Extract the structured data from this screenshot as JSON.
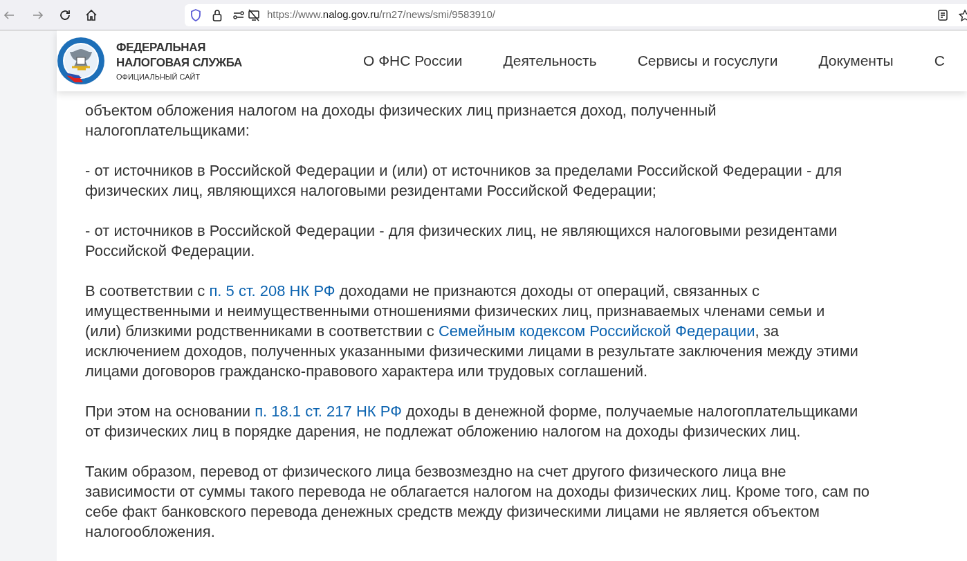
{
  "browser": {
    "url": {
      "prefix": "https://www.",
      "domain": "nalog.gov.ru",
      "path": "/rn27/news/smi/9583910/"
    }
  },
  "header": {
    "title_lines": [
      "ФЕДЕРАЛЬНАЯ",
      "НАЛОГОВАЯ СЛУЖБА"
    ],
    "subtitle": "ОФИЦИАЛЬНЫЙ САЙТ",
    "nav": [
      "О ФНС России",
      "Деятельность",
      "Сервисы и госуслуги",
      "Документы",
      "С"
    ]
  },
  "article": {
    "paragraphs": [
      [
        [
          {
            "text": "объектом обложения налогом на доходы физических лиц признается доход, полученный",
            "link": false
          }
        ],
        [
          {
            "text": "налогоплательщиками:",
            "link": false
          }
        ]
      ],
      [
        [
          {
            "text": "- от источников в Российской Федерации и (или) от источников за пределами Российской Федерации - для",
            "link": false
          }
        ],
        [
          {
            "text": "физических лиц, являющихся налоговыми резидентами Российской Федерации;",
            "link": false
          }
        ]
      ],
      [
        [
          {
            "text": "- от источников в Российской Федерации - для физических лиц, не являющихся налоговыми резидентами",
            "link": false
          }
        ],
        [
          {
            "text": "Российской Федерации.",
            "link": false
          }
        ]
      ],
      [
        [
          {
            "text": "В соответствии с ",
            "link": false
          },
          {
            "text": "п. 5 ст. 208 НК РФ",
            "link": true
          },
          {
            "text": " доходами не признаются доходы от операций, связанных с",
            "link": false
          }
        ],
        [
          {
            "text": "имущественными и неимущественными отношениями физических лиц, признаваемых членами семьи и",
            "link": false
          }
        ],
        [
          {
            "text": "(или) близкими родственниками в соответствии с ",
            "link": false
          },
          {
            "text": "Семейным кодексом Российской Федерации",
            "link": true
          },
          {
            "text": ", за",
            "link": false
          }
        ],
        [
          {
            "text": "исключением доходов, полученных указанными физическими лицами в результате заключения между этими",
            "link": false
          }
        ],
        [
          {
            "text": "лицами договоров гражданско-правового характера или трудовых соглашений.",
            "link": false
          }
        ]
      ],
      [
        [
          {
            "text": "При этом на основании ",
            "link": false
          },
          {
            "text": "п. 18.1 ст. 217 НК РФ",
            "link": true
          },
          {
            "text": " доходы в денежной форме, получаемые налогоплательщиками",
            "link": false
          }
        ],
        [
          {
            "text": "от физических лиц в порядке дарения, не подлежат обложению налогом на доходы физических лиц.",
            "link": false
          }
        ]
      ],
      [
        [
          {
            "text": "Таким образом, перевод от физического лица безвозмездно на счет другого физического лица вне",
            "link": false
          }
        ],
        [
          {
            "text": "зависимости от суммы такого перевода не облагается налогом на доходы физических лиц. Кроме того, сам по",
            "link": false
          }
        ],
        [
          {
            "text": "себе факт банковского перевода денежных средств между физическими лицами не является объектом",
            "link": false
          }
        ],
        [
          {
            "text": "налогообложения.",
            "link": false
          }
        ]
      ]
    ]
  }
}
